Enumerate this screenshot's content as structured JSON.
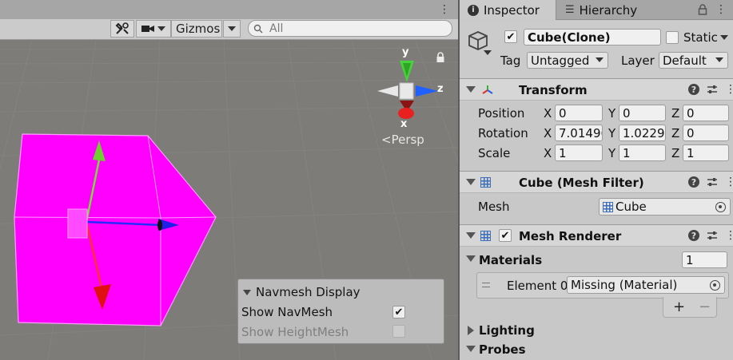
{
  "scene": {
    "toolbar": {
      "gizmos_label": "Gizmos",
      "search_placeholder": "All"
    },
    "gizmo": {
      "x_label": "x",
      "y_label": "y",
      "z_label": "z",
      "projection_label": "Persp"
    },
    "navmesh_display": {
      "title": "Navmesh Display",
      "show_navmesh_label": "Show NavMesh",
      "show_navmesh_checked": true,
      "show_heightmesh_label": "Show HeightMesh",
      "show_heightmesh_checked": false
    },
    "colors": {
      "cube": "#ff00ff",
      "background": "#7d7c79"
    }
  },
  "inspector": {
    "tabs": [
      {
        "label": "Inspector"
      },
      {
        "label": "Hierarchy"
      }
    ],
    "object": {
      "active": true,
      "name": "Cube(Clone)",
      "static_label": "Static",
      "static_checked": false,
      "tag_label": "Tag",
      "tag_value": "Untagged",
      "layer_label": "Layer",
      "layer_value": "Default"
    },
    "transform": {
      "title": "Transform",
      "position_label": "Position",
      "rotation_label": "Rotation",
      "scale_label": "Scale",
      "position": {
        "x": "0",
        "y": "0",
        "z": "0"
      },
      "rotation": {
        "x": "7.01496",
        "y": "1.02294",
        "z": "0"
      },
      "scale": {
        "x": "1",
        "y": "1",
        "z": "1"
      },
      "axis_x": "X",
      "axis_y": "Y",
      "axis_z": "Z"
    },
    "mesh_filter": {
      "title": "Cube (Mesh Filter)",
      "mesh_label": "Mesh",
      "mesh_value": "Cube"
    },
    "mesh_renderer": {
      "title": "Mesh Renderer",
      "enabled": true,
      "materials_label": "Materials",
      "materials_count": "1",
      "element_label": "Element 0",
      "element_value": "Missing (Material)",
      "add_label": "+",
      "remove_label": "−",
      "lighting_label": "Lighting",
      "probes_label": "Probes"
    }
  }
}
